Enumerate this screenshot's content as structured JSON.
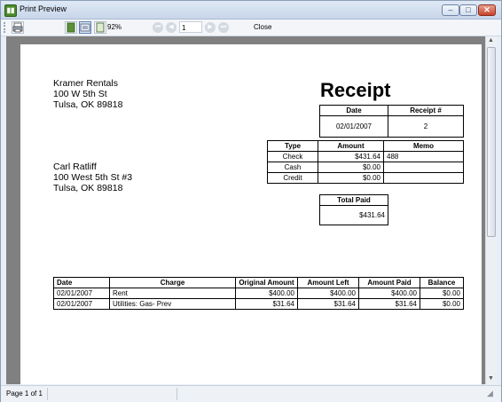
{
  "window": {
    "title": "Print Preview"
  },
  "toolbar": {
    "zoom": "92%",
    "page_number": "1",
    "close_label": "Close"
  },
  "receipt": {
    "title": "Receipt",
    "from": [
      "Kramer Rentals",
      "100 W 5th St",
      "Tulsa, OK 89818"
    ],
    "to": [
      "Carl Ratliff",
      "100 West 5th St #3",
      "Tulsa, OK 89818"
    ],
    "date_header": "Date",
    "receipt_no_header": "Receipt #",
    "date": "02/01/2007",
    "receipt_no": "2",
    "payment_headers": [
      "Type",
      "Amount",
      "Memo"
    ],
    "payments": [
      {
        "type": "Check",
        "amount": "$431.64",
        "memo": "488"
      },
      {
        "type": "Cash",
        "amount": "$0.00",
        "memo": ""
      },
      {
        "type": "Credit",
        "amount": "$0.00",
        "memo": ""
      }
    ],
    "total_paid_label": "Total Paid",
    "total_paid": "$431.64",
    "charge_headers": [
      "Date",
      "Charge",
      "Original Amount",
      "Amount Left",
      "Amount Paid",
      "Balance"
    ],
    "charges": [
      {
        "date": "02/01/2007",
        "charge": "Rent",
        "original": "$400.00",
        "left": "$400.00",
        "paid": "$400.00",
        "balance": "$0.00"
      },
      {
        "date": "02/01/2007",
        "charge": "Utilities: Gas- Prev",
        "original": "$31.64",
        "left": "$31.64",
        "paid": "$31.64",
        "balance": "$0.00"
      }
    ]
  },
  "status": {
    "page_info": "Page 1 of 1"
  }
}
